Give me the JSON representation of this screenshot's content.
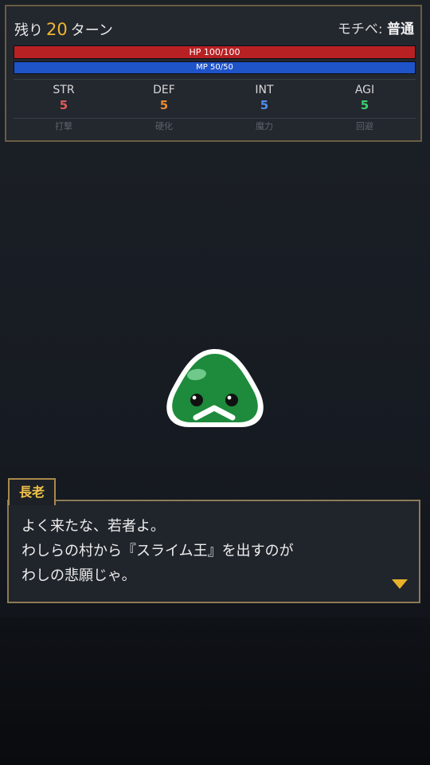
{
  "status": {
    "turns_prefix": "残り",
    "turns_value": "20",
    "turns_suffix": "ターン",
    "motivation_label": "モチベ:",
    "motivation_value": "普通",
    "hp": {
      "label": "HP 100/100",
      "current": 100,
      "max": 100
    },
    "mp": {
      "label": "MP 50/50",
      "current": 50,
      "max": 50
    },
    "stats": [
      {
        "label": "STR",
        "value": "5",
        "sub": "打撃",
        "color": "#e05a5a"
      },
      {
        "label": "DEF",
        "value": "5",
        "sub": "硬化",
        "color": "#ee8a2e"
      },
      {
        "label": "INT",
        "value": "5",
        "sub": "魔力",
        "color": "#4f8ff0"
      },
      {
        "label": "AGI",
        "value": "5",
        "sub": "回避",
        "color": "#3ccf6e"
      }
    ]
  },
  "character": {
    "icon": "green-slime-icon",
    "color": "#1e8a3c"
  },
  "dialogue": {
    "speaker": "長老",
    "lines": [
      "よく来たな、若者よ。",
      "わしらの村から『スライム王』を出すのが",
      "わしの悲願じゃ。"
    ],
    "advance_icon": "triangle-down-icon"
  },
  "colors": {
    "accent_gold": "#f0b530",
    "panel_border": "#6b5d42",
    "hp_bar": "#b82124",
    "mp_bar": "#1f53c8"
  }
}
